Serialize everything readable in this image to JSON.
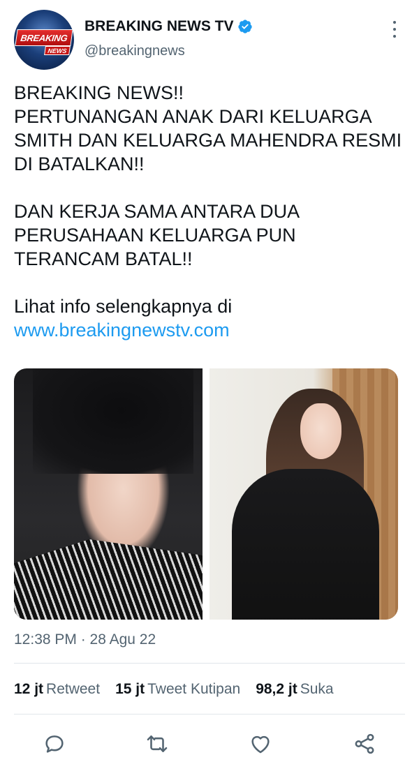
{
  "account": {
    "display_name": "BREAKING NEWS TV",
    "handle": "@breakingnews",
    "verified": true,
    "avatar_logo_main": "BREAKING",
    "avatar_logo_sub": "NEWS"
  },
  "tweet": {
    "paragraphs": [
      "BREAKING NEWS!!\nPERTUNANGAN ANAK DARI KELUARGA SMITH DAN KELUARGA MAHENDRA RESMI DI BATALKAN!!",
      "DAN KERJA SAMA ANTARA DUA PERUSAHAAN KELUARGA PUN TERANCAM BATAL!!"
    ],
    "cta_text": "Lihat info selengkapnya di",
    "link": "www.breakingnewstv.com",
    "timestamp": "12:38 PM · 28 Agu 22"
  },
  "media": [
    {
      "icon": "photo-man-portrait"
    },
    {
      "icon": "photo-woman-black-coat"
    }
  ],
  "stats": {
    "retweets_count": "12 jt",
    "retweets_label": "Retweet",
    "quotes_count": "15 jt",
    "quotes_label": "Tweet Kutipan",
    "likes_count": "98,2 jt",
    "likes_label": "Suka"
  },
  "actions": {
    "reply_icon": "reply-icon",
    "retweet_icon": "retweet-icon",
    "like_icon": "heart-icon",
    "share_icon": "share-icon"
  },
  "colors": {
    "link": "#1d9bf0",
    "secondary_text": "#536471",
    "primary_text": "#0f1419",
    "verified": "#1d9bf0"
  }
}
